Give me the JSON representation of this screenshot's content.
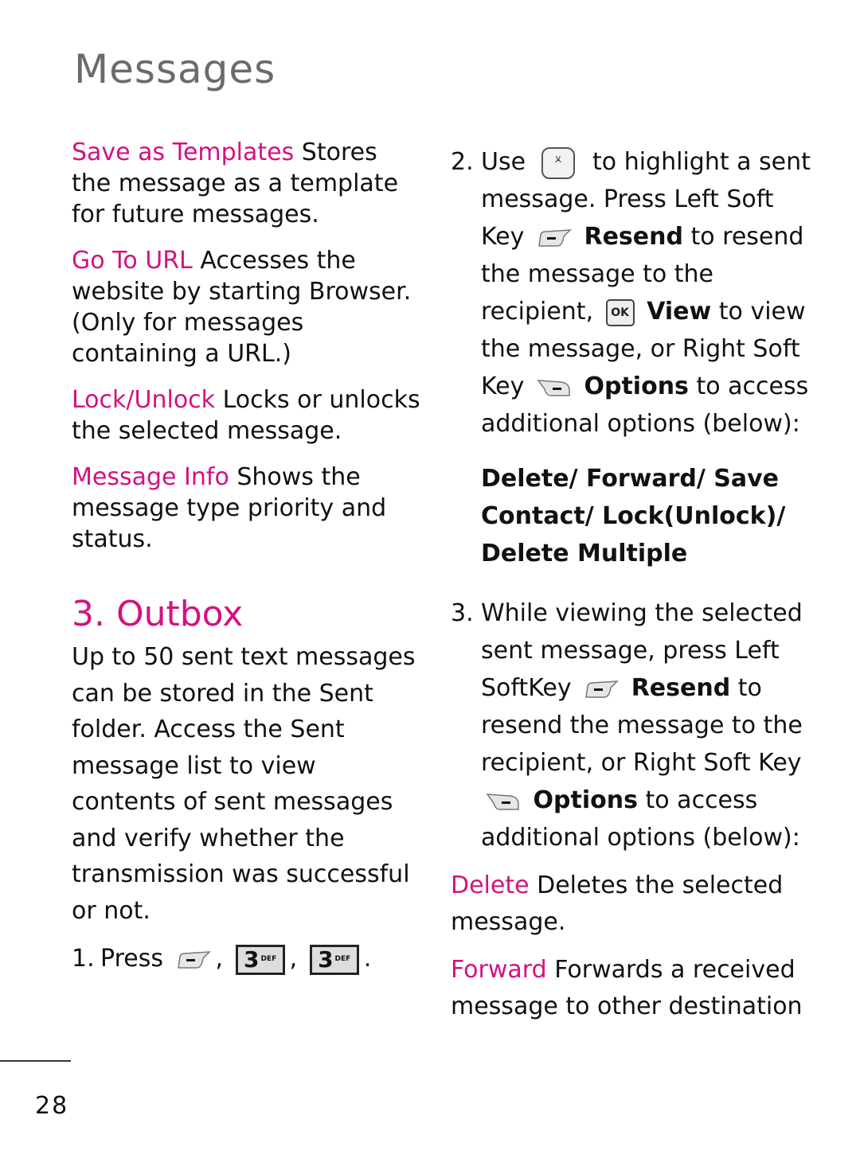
{
  "header": {
    "title": "Messages"
  },
  "accent_color": "#d4117f",
  "left": {
    "definitions": [
      {
        "term": "Save as Templates",
        "text": "Stores the message as a template for future messages."
      },
      {
        "term": "Go To URL",
        "text": "Accesses the website by starting Browser. (Only for messages containing a URL.)"
      },
      {
        "term": "Lock/Unlock",
        "text": "Locks or unlocks the selected message."
      },
      {
        "term": "Message Info",
        "text": "Shows the message type priority and status."
      }
    ],
    "section_title": "3. Outbox",
    "section_body": "Up to 50 sent text messages can be stored in the Sent folder. Access the Sent message list to view contents of sent messages and verify whether the transmission was successful or not.",
    "step1": {
      "num": "1.",
      "text": "Press",
      "sep1": ",",
      "sep2": ",",
      "end": ".",
      "keys": [
        {
          "icon": "left-soft-key-icon"
        },
        {
          "icon": "number-key-3-icon",
          "digit": "3",
          "letters": "DEF"
        },
        {
          "icon": "number-key-3-icon",
          "digit": "3",
          "letters": "DEF"
        }
      ]
    }
  },
  "right": {
    "step2": {
      "num": "2.",
      "t1": "Use",
      "t2": "to highlight a sent message. Press Left Soft Key",
      "resend": "Resend",
      "t3": "to resend the message to the recipient,",
      "ok_label": "OK",
      "view": "View",
      "t4": "to view the message, or Right Soft Key",
      "options": "Options",
      "t5": "to access additional options (below):"
    },
    "options_list": "Delete/ Forward/ Save Contact/ Lock(Unlock)/ Delete Multiple",
    "step3": {
      "num": "3.",
      "t1": "While viewing the selected sent message, press Left SoftKey",
      "resend": "Resend",
      "t2": "to resend the message to the recipient, or Right Soft Key",
      "options": "Options",
      "t3": "to access additional options (below):"
    },
    "definitions": [
      {
        "term": "Delete",
        "text": "Deletes the selected message."
      },
      {
        "term": "Forward",
        "text": "Forwards a received message to other destination"
      }
    ]
  },
  "footer": {
    "page_number": "28"
  }
}
